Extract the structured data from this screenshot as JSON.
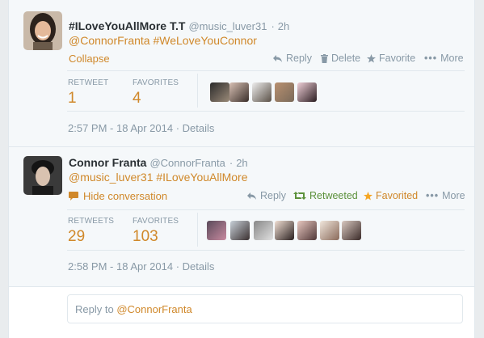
{
  "tweet1": {
    "display_name": "#ILoveYouAllMore T.T",
    "handle": "@music_luver31",
    "age": "2h",
    "text": "@ConnorFranta #WeLoveYouConnor",
    "collapse": "Collapse",
    "actions": {
      "reply": "Reply",
      "delete": "Delete",
      "favorite": "Favorite",
      "more": "More"
    },
    "stats": {
      "retweet_label": "RETWEET",
      "retweet_count": "1",
      "favorites_label": "FAVORITES",
      "favorites_count": "4"
    },
    "timestamp": "2:57 PM - 18 Apr 2014",
    "details": "Details"
  },
  "tweet2": {
    "display_name": "Connor Franta",
    "handle": "@ConnorFranta",
    "age": "2h",
    "text": "@music_luver31 #ILoveYouAllMore",
    "hide": "Hide conversation",
    "actions": {
      "reply": "Reply",
      "retweeted": "Retweeted",
      "favorited": "Favorited",
      "more": "More"
    },
    "stats": {
      "retweets_label": "RETWEETS",
      "retweets_count": "29",
      "favorites_label": "FAVORITES",
      "favorites_count": "103"
    },
    "timestamp": "2:58 PM - 18 Apr 2014",
    "details": "Details"
  },
  "reply_box": {
    "prefix": "Reply to ",
    "mention": "@ConnorFranta"
  },
  "colors": {
    "accent": "#d0882a",
    "retweet_green": "#5c913b",
    "muted": "#8899a6"
  }
}
